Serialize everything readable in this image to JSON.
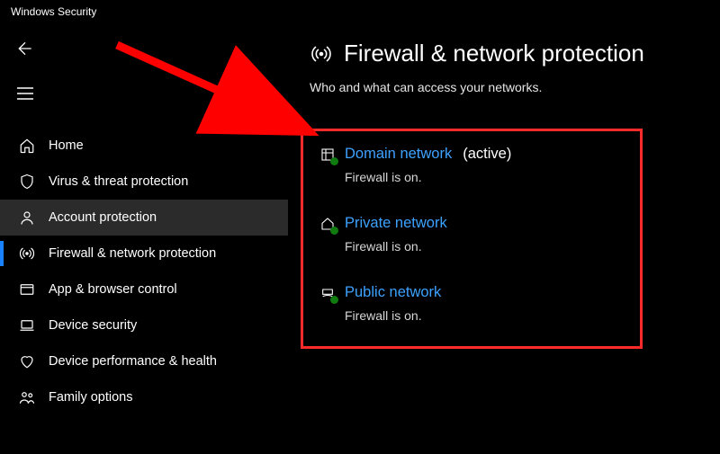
{
  "window": {
    "title": "Windows Security"
  },
  "sidebar": {
    "items": [
      {
        "label": "Home"
      },
      {
        "label": "Virus & threat protection"
      },
      {
        "label": "Account protection"
      },
      {
        "label": "Firewall & network protection"
      },
      {
        "label": "App & browser control"
      },
      {
        "label": "Device security"
      },
      {
        "label": "Device performance & health"
      },
      {
        "label": "Family options"
      }
    ]
  },
  "page": {
    "title": "Firewall & network protection",
    "subtitle": "Who and what can access your networks."
  },
  "networks": [
    {
      "label": "Domain network",
      "active_suffix": "(active)",
      "status": "Firewall is on."
    },
    {
      "label": "Private network",
      "active_suffix": "",
      "status": "Firewall is on."
    },
    {
      "label": "Public network",
      "active_suffix": "",
      "status": "Firewall is on."
    }
  ]
}
